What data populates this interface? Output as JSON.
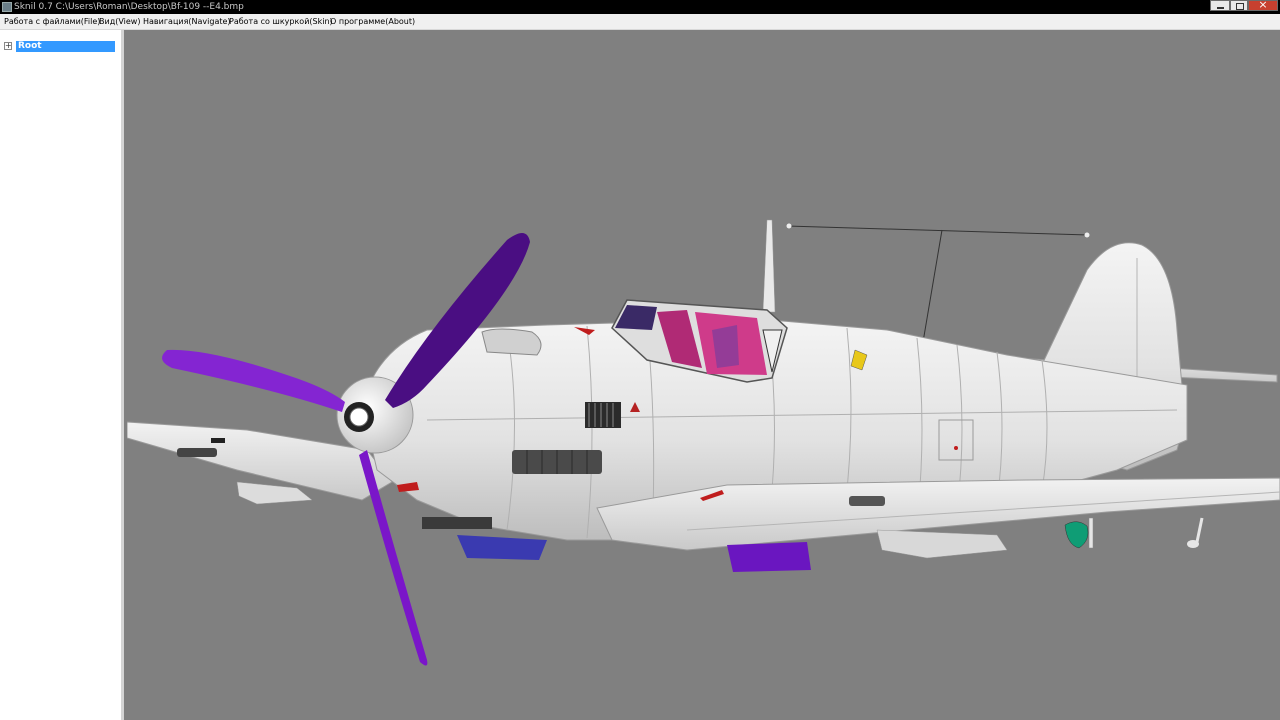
{
  "window": {
    "title": "Sknil 0.7   C:\\Users\\Roman\\Desktop\\Bf-109 --E4.bmp",
    "icon": "app-icon",
    "controls": [
      "minimize-icon",
      "maximize-icon",
      "close-icon"
    ]
  },
  "menubar": {
    "items": [
      {
        "label": "Работа с файлами(File)"
      },
      {
        "label": "Вид(View)"
      },
      {
        "label": "Навигация(Navigate)"
      },
      {
        "label": "Работа со шкуркой(Skin)"
      },
      {
        "label": "О программе(About)"
      }
    ]
  },
  "tree": {
    "root": {
      "label": "Root",
      "expander": "+",
      "selected": true
    }
  },
  "viewport": {
    "background": "#808080",
    "model": "aircraft-model",
    "propeller_color": "#7a16c9",
    "fuselage_color": "#e6e6e6"
  }
}
